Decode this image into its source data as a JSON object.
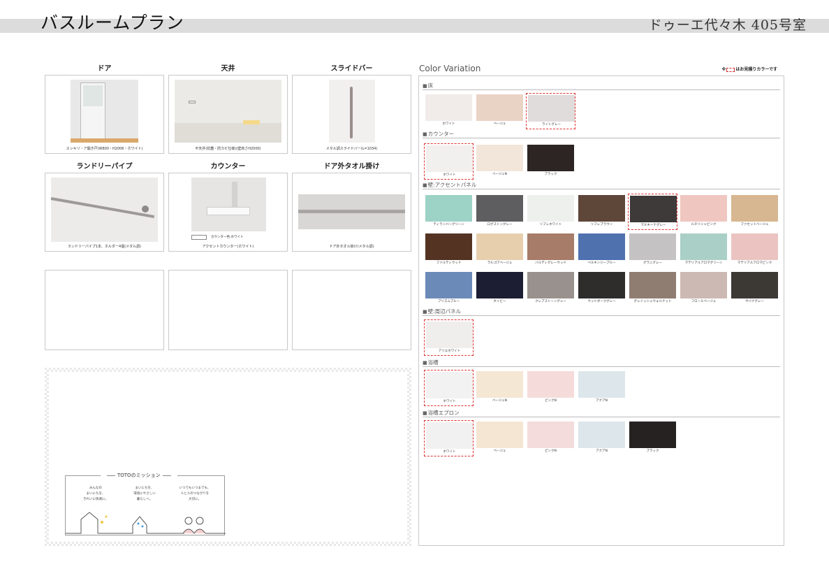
{
  "header": {
    "title": "バスルームプラン",
    "room": "ドゥーエ代々木 405号室"
  },
  "specs": [
    {
      "heading": "ドア",
      "caption": "スッキリ・ア開き戸(W800・H2006・ホワイト)"
    },
    {
      "heading": "天井",
      "caption": "平天井(抗菌・防カビ仕様)(壁高さH2000)"
    },
    {
      "heading": "スライドバー",
      "caption": "メタル調スライドバー(L=1034)"
    },
    {
      "heading": "ランドリーパイプ",
      "caption": "ランドリーパイプ1本、ホルダー4個(メタル調)"
    },
    {
      "heading": "カウンター",
      "caption": "アクセントカウンター(ホワイト)",
      "sub_caption": "カウンター色:ホワイト"
    },
    {
      "heading": "ドア外タオル掛け",
      "caption": "ドア外タオル掛け(メタル調)"
    }
  ],
  "mission": {
    "title": "TOTOのミッション",
    "columns": [
      {
        "lines": [
          "みんなの",
          "まいにちを、",
          "きれいに快適に。"
        ]
      },
      {
        "lines": [
          "まいにちを、",
          "環境にやさしい",
          "暮らしへ。"
        ]
      },
      {
        "lines": [
          "いつでもいつまでも、",
          "人と人のつながりを",
          "大切に。"
        ]
      }
    ]
  },
  "color_variation": {
    "title": "Color Variation",
    "note_prefix": "※",
    "note_suffix": "はお見積りカラーです",
    "sections": [
      {
        "name": "床",
        "swatches": [
          {
            "label": "ホワイト",
            "color": "#f1ecea",
            "selected": false
          },
          {
            "label": "ベージュ",
            "color": "#e9d3c4",
            "selected": false
          },
          {
            "label": "ライトグレー",
            "color": "#e1dcdc",
            "selected": true
          }
        ]
      },
      {
        "name": "カウンター",
        "swatches": [
          {
            "label": "ホワイト",
            "color": "#f2f0ef",
            "selected": true
          },
          {
            "label": "ベージュN",
            "color": "#f2e6da",
            "selected": false
          },
          {
            "label": "ブラック",
            "color": "#2c2524",
            "selected": false
          }
        ]
      },
      {
        "name": "壁:アクセントパネル",
        "swatches": [
          {
            "label": "ティランバーグリーン",
            "color": "#9dd2c6",
            "selected": false
          },
          {
            "label": "ログストングレー",
            "color": "#5e5e60",
            "selected": false
          },
          {
            "label": "リフレホワイト",
            "color": "#eef0ee",
            "selected": false
          },
          {
            "label": "リフレブラウン",
            "color": "#5e4638",
            "selected": false
          },
          {
            "label": "マルキーナグレー",
            "color": "#3d3a39",
            "selected": true
          },
          {
            "label": "ルチリシャピンク",
            "color": "#efc7c0",
            "selected": false
          },
          {
            "label": "ファセットベージュ",
            "color": "#d7b791",
            "selected": false
          },
          {
            "label": "ファルティウッド",
            "color": "#553323",
            "selected": false
          },
          {
            "label": "ラルゴアベージュ",
            "color": "#e7cfae",
            "selected": false
          },
          {
            "label": "バルディグレーウッド",
            "color": "#a77c69",
            "selected": false
          },
          {
            "label": "ベルキンジーブルー",
            "color": "#4f71ae",
            "selected": false
          },
          {
            "label": "グラニグレー",
            "color": "#c4c2c2",
            "selected": false
          },
          {
            "label": "マテリアルアロマグリーン",
            "color": "#a9cfc6",
            "selected": false
          },
          {
            "label": "マテリアルアロマピンク",
            "color": "#ebc4c1",
            "selected": false
          },
          {
            "label": "プリズムブルー",
            "color": "#6b8ab8",
            "selected": false
          },
          {
            "label": "ネイビー",
            "color": "#1c1e33",
            "selected": false
          },
          {
            "label": "クレアストーングレー",
            "color": "#99918d",
            "selected": false
          },
          {
            "label": "ウッドダークグレー",
            "color": "#2f2c2c",
            "selected": false
          },
          {
            "label": "グレイッシュウォルナット",
            "color": "#907d72",
            "selected": false
          },
          {
            "label": "フロールベージュ",
            "color": "#cdb9b3",
            "selected": false
          },
          {
            "label": "サバナグレー",
            "color": "#3c3834",
            "selected": false
          }
        ]
      },
      {
        "name": "壁:周辺パネル",
        "swatches": [
          {
            "label": "アリエホワイト",
            "color": "#f0eeed",
            "selected": true
          }
        ]
      },
      {
        "name": "浴槽",
        "swatches": [
          {
            "label": "ホワイト",
            "color": "#f3f2f2",
            "selected": true
          },
          {
            "label": "ベージュN",
            "color": "#f4e7d4",
            "selected": false
          },
          {
            "label": "ピンクN",
            "color": "#f5dcda",
            "selected": false
          },
          {
            "label": "アクアN",
            "color": "#dde6ea",
            "selected": false
          }
        ]
      },
      {
        "name": "浴槽エプロン",
        "swatches": [
          {
            "label": "ホワイト",
            "color": "#f2f1f1",
            "selected": true
          },
          {
            "label": "ベージュ",
            "color": "#f4e6d3",
            "selected": false
          },
          {
            "label": "ピンクN",
            "color": "#f3dcdb",
            "selected": false
          },
          {
            "label": "アクアN",
            "color": "#dde6ea",
            "selected": false
          },
          {
            "label": "ブラック",
            "color": "#262222",
            "selected": false
          }
        ]
      }
    ]
  }
}
